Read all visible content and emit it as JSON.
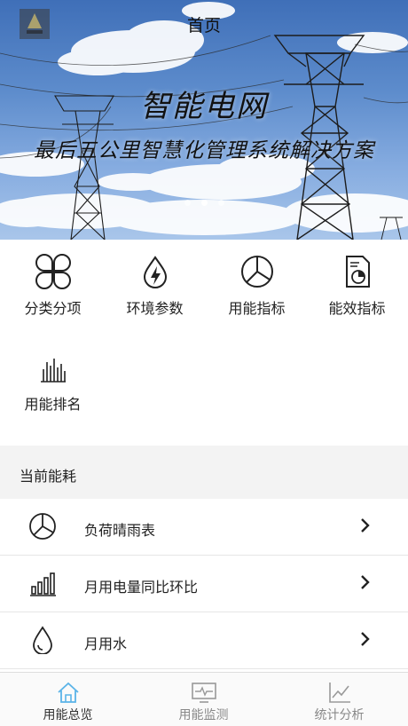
{
  "header": {
    "title": "首页"
  },
  "banner": {
    "headline": "智能电网",
    "subheadline": "最后五公里智慧化管理系统解决方案",
    "slide_count": 3,
    "active_slide": 2
  },
  "features": [
    {
      "label": "分类分项",
      "icon": "clover-icon"
    },
    {
      "label": "环境参数",
      "icon": "energy-drop-icon"
    },
    {
      "label": "用能指标",
      "icon": "pie-chart-icon"
    },
    {
      "label": "能效指标",
      "icon": "report-icon"
    },
    {
      "label": "用能排名",
      "icon": "bar-ranking-icon"
    }
  ],
  "section": {
    "title": "当前能耗"
  },
  "list": [
    {
      "label": "负荷晴雨表",
      "icon": "pie-chart-icon"
    },
    {
      "label": "月用电量同比环比",
      "icon": "bar-chart-icon"
    },
    {
      "label": "月用水",
      "icon": "water-drop-icon"
    }
  ],
  "tabs": [
    {
      "label": "用能总览",
      "icon": "home-icon",
      "active": true
    },
    {
      "label": "用能监测",
      "icon": "monitor-icon",
      "active": false
    },
    {
      "label": "统计分析",
      "icon": "line-chart-icon",
      "active": false
    }
  ],
  "colors": {
    "accent": "#5bb4e8",
    "inactive_tab": "#888888",
    "section_bg": "#f3f3f3"
  }
}
